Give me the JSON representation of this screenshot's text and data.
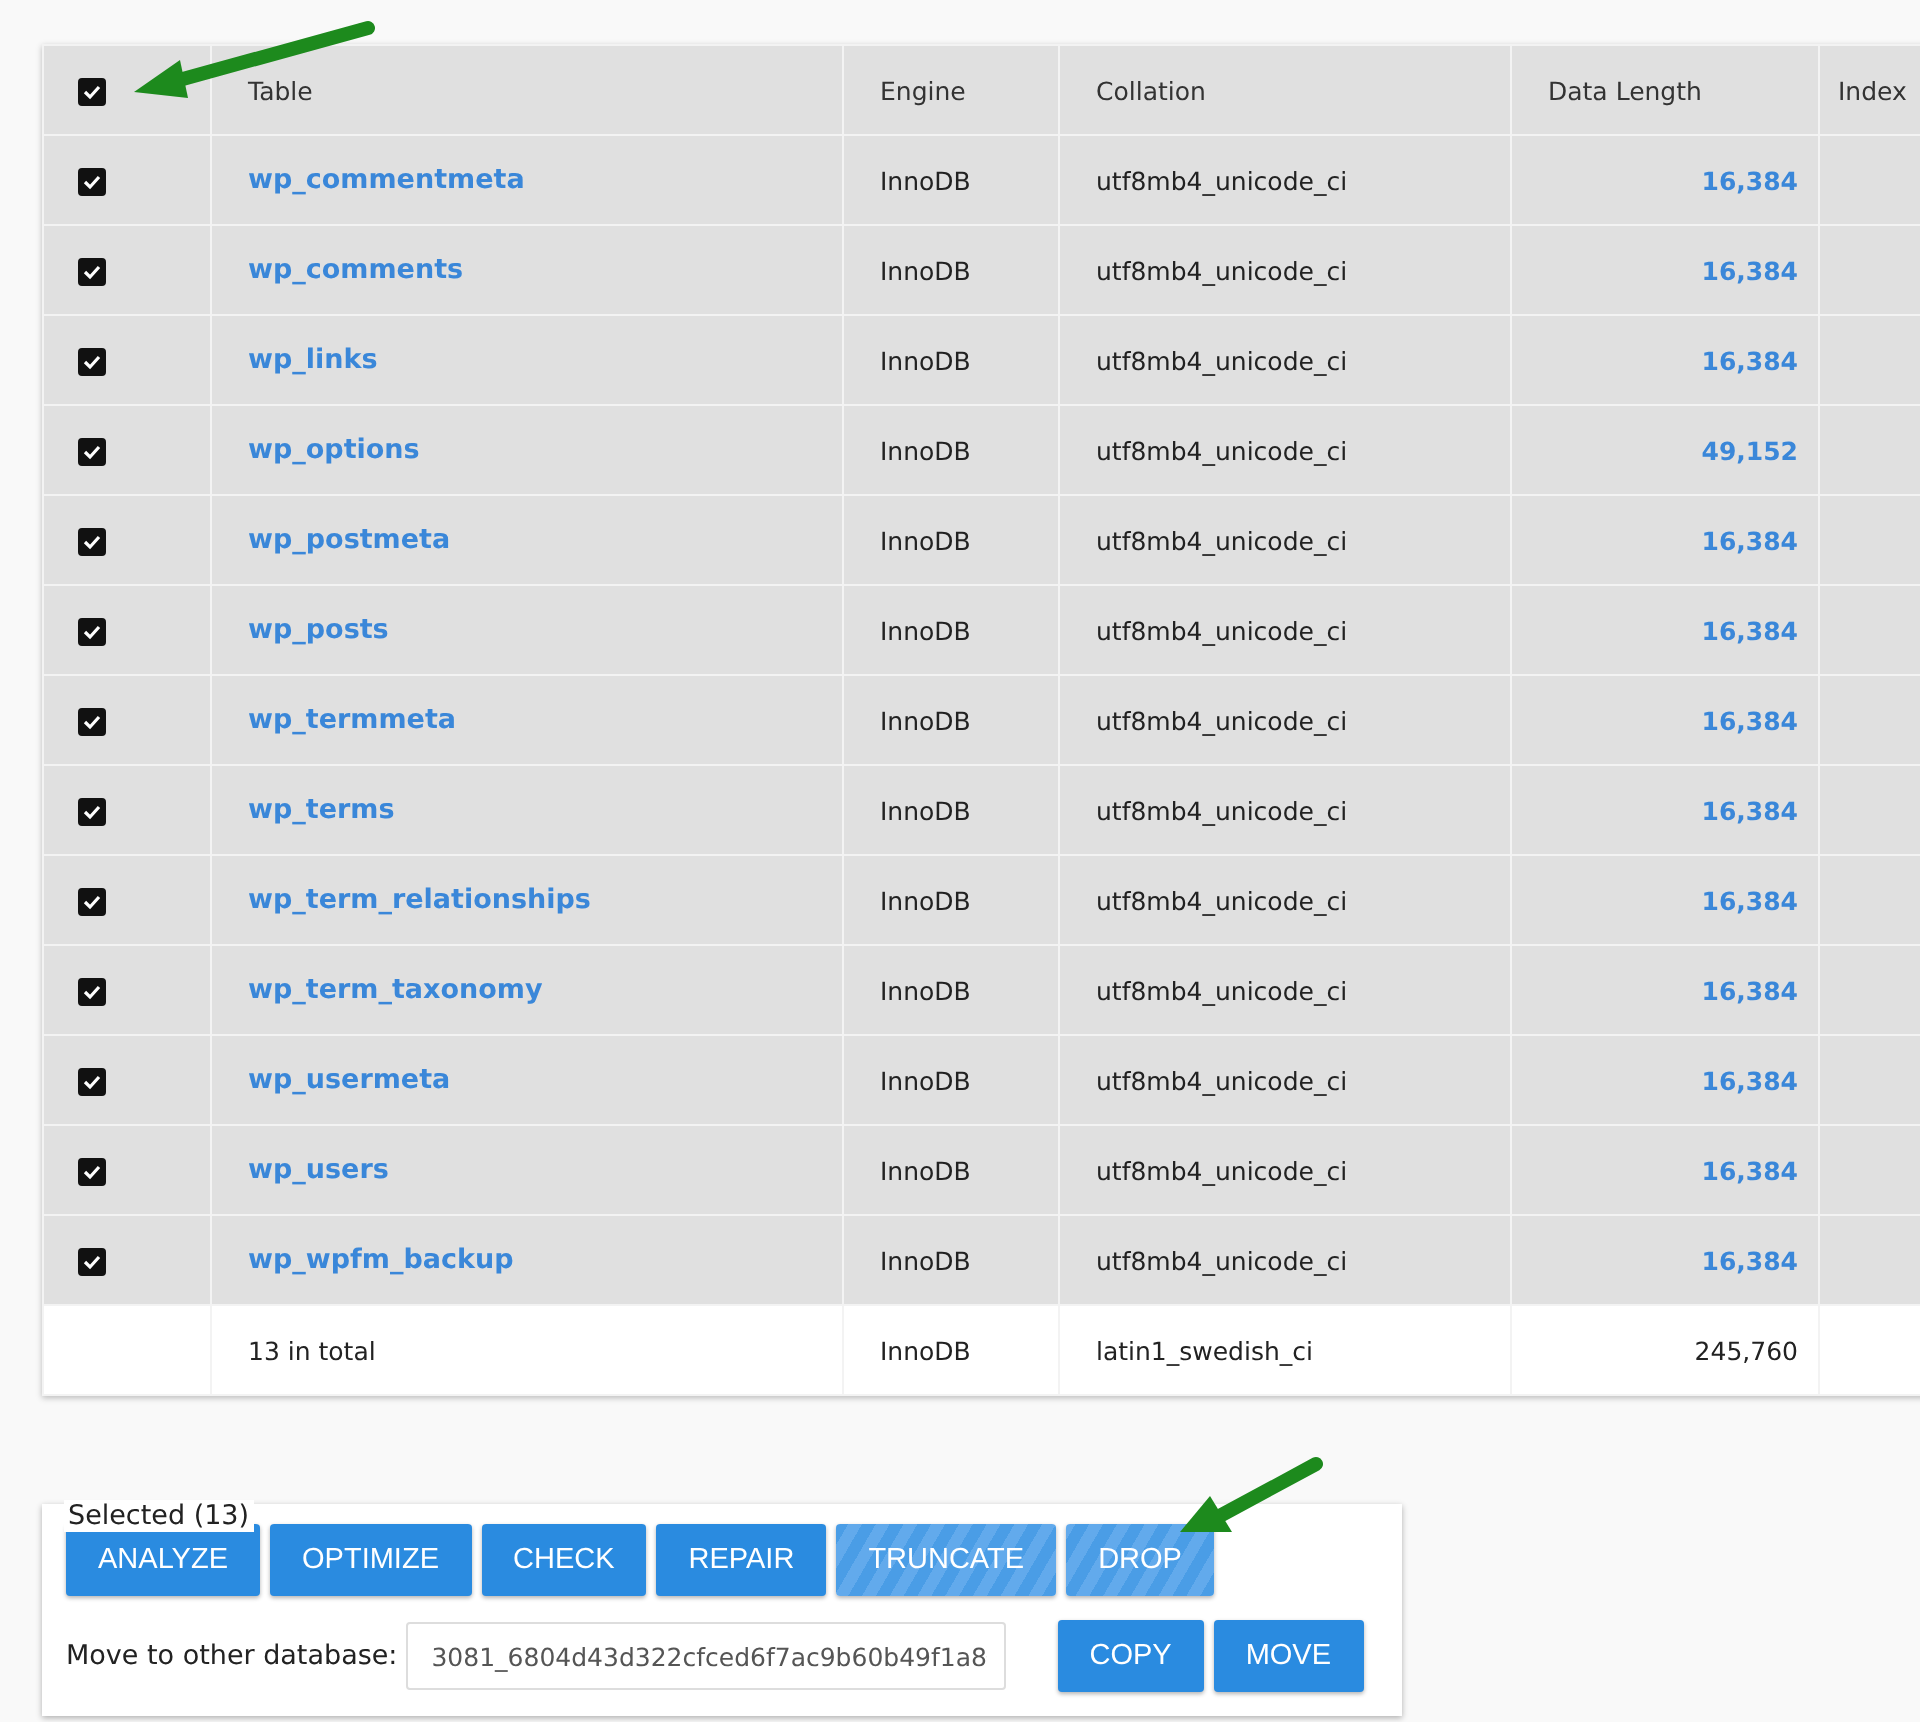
{
  "table": {
    "select_all": {
      "checked": true
    },
    "columns": [
      "Table",
      "Engine",
      "Collation",
      "Data Length",
      "Index"
    ],
    "rows": [
      {
        "checked": true,
        "name": "wp_commentmeta",
        "engine": "InnoDB",
        "collation": "utf8mb4_unicode_ci",
        "data_length": "16,384"
      },
      {
        "checked": true,
        "name": "wp_comments",
        "engine": "InnoDB",
        "collation": "utf8mb4_unicode_ci",
        "data_length": "16,384"
      },
      {
        "checked": true,
        "name": "wp_links",
        "engine": "InnoDB",
        "collation": "utf8mb4_unicode_ci",
        "data_length": "16,384"
      },
      {
        "checked": true,
        "name": "wp_options",
        "engine": "InnoDB",
        "collation": "utf8mb4_unicode_ci",
        "data_length": "49,152"
      },
      {
        "checked": true,
        "name": "wp_postmeta",
        "engine": "InnoDB",
        "collation": "utf8mb4_unicode_ci",
        "data_length": "16,384"
      },
      {
        "checked": true,
        "name": "wp_posts",
        "engine": "InnoDB",
        "collation": "utf8mb4_unicode_ci",
        "data_length": "16,384"
      },
      {
        "checked": true,
        "name": "wp_termmeta",
        "engine": "InnoDB",
        "collation": "utf8mb4_unicode_ci",
        "data_length": "16,384"
      },
      {
        "checked": true,
        "name": "wp_terms",
        "engine": "InnoDB",
        "collation": "utf8mb4_unicode_ci",
        "data_length": "16,384"
      },
      {
        "checked": true,
        "name": "wp_term_relationships",
        "engine": "InnoDB",
        "collation": "utf8mb4_unicode_ci",
        "data_length": "16,384"
      },
      {
        "checked": true,
        "name": "wp_term_taxonomy",
        "engine": "InnoDB",
        "collation": "utf8mb4_unicode_ci",
        "data_length": "16,384"
      },
      {
        "checked": true,
        "name": "wp_usermeta",
        "engine": "InnoDB",
        "collation": "utf8mb4_unicode_ci",
        "data_length": "16,384"
      },
      {
        "checked": true,
        "name": "wp_users",
        "engine": "InnoDB",
        "collation": "utf8mb4_unicode_ci",
        "data_length": "16,384"
      },
      {
        "checked": true,
        "name": "wp_wpfm_backup",
        "engine": "InnoDB",
        "collation": "utf8mb4_unicode_ci",
        "data_length": "16,384"
      }
    ],
    "total": {
      "label": "13 in total",
      "engine": "InnoDB",
      "collation": "latin1_swedish_ci",
      "data_length": "245,760"
    }
  },
  "selected_panel": {
    "legend": "Selected (13)",
    "buttons": [
      {
        "label": "ANALYZE",
        "striped": false
      },
      {
        "label": "OPTIMIZE",
        "striped": false
      },
      {
        "label": "CHECK",
        "striped": false
      },
      {
        "label": "REPAIR",
        "striped": false
      },
      {
        "label": "TRUNCATE",
        "striped": true
      },
      {
        "label": "DROP",
        "striped": true
      }
    ],
    "move_label": "Move to other database:",
    "database_select": {
      "value": "3081_6804d43d322cfced6f7ac9b60b49f1a8"
    },
    "move_buttons": [
      {
        "label": "COPY"
      },
      {
        "label": "MOVE"
      }
    ]
  }
}
